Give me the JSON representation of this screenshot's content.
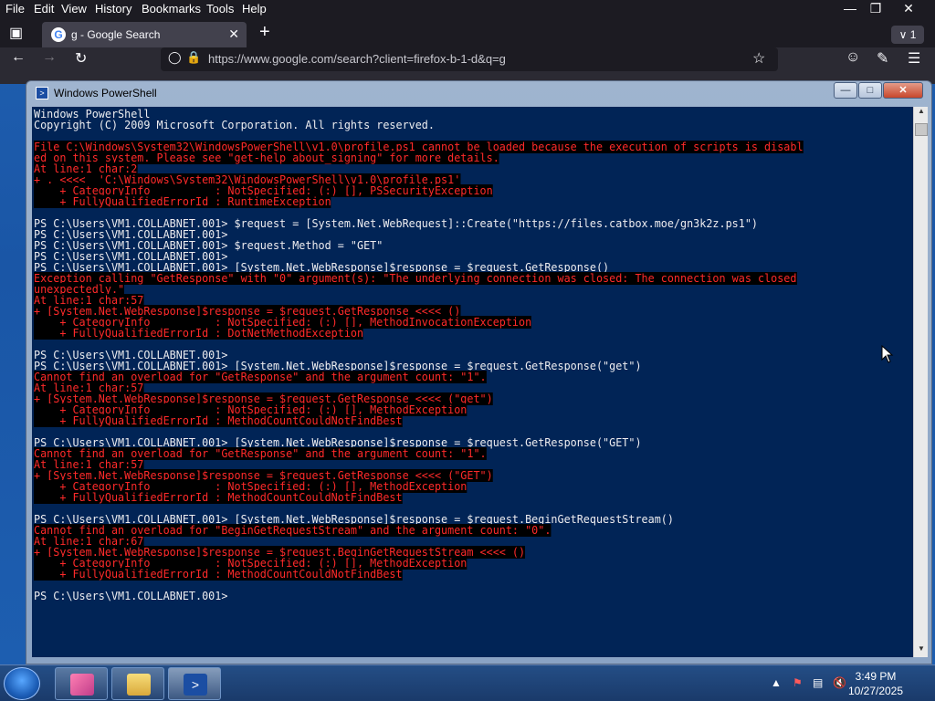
{
  "firefox": {
    "menu": [
      "File",
      "Edit",
      "View",
      "History",
      "Bookmarks",
      "Tools",
      "Help"
    ],
    "tab_title": "g - Google Search",
    "url": "https://www.google.com/search?client=firefox-b-1-d&q=g",
    "tab_count": "1"
  },
  "powershell": {
    "title": "Windows PowerShell",
    "lines": [
      {
        "t": "Windows PowerShell",
        "err": false
      },
      {
        "t": "Copyright (C) 2009 Microsoft Corporation. All rights reserved.",
        "err": false
      },
      {
        "t": "",
        "err": false
      },
      {
        "t": "File C:\\Windows\\System32\\WindowsPowerShell\\v1.0\\profile.ps1 cannot be loaded because the execution of scripts is disabl",
        "err": true
      },
      {
        "t": "ed on this system. Please see \"get-help about_signing\" for more details.",
        "err": true
      },
      {
        "t": "At line:1 char:2",
        "err": true
      },
      {
        "t": "+ . <<<<  'C:\\Windows\\System32\\WindowsPowerShell\\v1.0\\profile.ps1'",
        "err": true
      },
      {
        "t": "    + CategoryInfo          : NotSpecified: (:) [], PSSecurityException",
        "err": true
      },
      {
        "t": "    + FullyQualifiedErrorId : RuntimeException",
        "err": true
      },
      {
        "t": "",
        "err": false
      },
      {
        "t": "PS C:\\Users\\VM1.COLLABNET.001> $request = [System.Net.WebRequest]::Create(\"https://files.catbox.moe/gn3k2z.ps1\")",
        "err": false
      },
      {
        "t": "PS C:\\Users\\VM1.COLLABNET.001>",
        "err": false
      },
      {
        "t": "PS C:\\Users\\VM1.COLLABNET.001> $request.Method = \"GET\"",
        "err": false
      },
      {
        "t": "PS C:\\Users\\VM1.COLLABNET.001>",
        "err": false
      },
      {
        "t": "PS C:\\Users\\VM1.COLLABNET.001> [System.Net.WebResponse]$response = $request.GetResponse()",
        "err": false
      },
      {
        "t": "Exception calling \"GetResponse\" with \"0\" argument(s): \"The underlying connection was closed: The connection was closed",
        "err": true
      },
      {
        "t": "unexpectedly.\"",
        "err": true
      },
      {
        "t": "At line:1 char:57",
        "err": true
      },
      {
        "t": "+ [System.Net.WebResponse]$response = $request.GetResponse <<<< ()",
        "err": true
      },
      {
        "t": "    + CategoryInfo          : NotSpecified: (:) [], MethodInvocationException",
        "err": true
      },
      {
        "t": "    + FullyQualifiedErrorId : DotNetMethodException",
        "err": true
      },
      {
        "t": "",
        "err": false
      },
      {
        "t": "PS C:\\Users\\VM1.COLLABNET.001>",
        "err": false
      },
      {
        "t": "PS C:\\Users\\VM1.COLLABNET.001> [System.Net.WebResponse]$response = $request.GetResponse(\"get\")",
        "err": false
      },
      {
        "t": "Cannot find an overload for \"GetResponse\" and the argument count: \"1\".",
        "err": true
      },
      {
        "t": "At line:1 char:57",
        "err": true
      },
      {
        "t": "+ [System.Net.WebResponse]$response = $request.GetResponse <<<< (\"get\")",
        "err": true
      },
      {
        "t": "    + CategoryInfo          : NotSpecified: (:) [], MethodException",
        "err": true
      },
      {
        "t": "    + FullyQualifiedErrorId : MethodCountCouldNotFindBest",
        "err": true
      },
      {
        "t": "",
        "err": false
      },
      {
        "t": "PS C:\\Users\\VM1.COLLABNET.001> [System.Net.WebResponse]$response = $request.GetResponse(\"GET\")",
        "err": false
      },
      {
        "t": "Cannot find an overload for \"GetResponse\" and the argument count: \"1\".",
        "err": true
      },
      {
        "t": "At line:1 char:57",
        "err": true
      },
      {
        "t": "+ [System.Net.WebResponse]$response = $request.GetResponse <<<< (\"GET\")",
        "err": true
      },
      {
        "t": "    + CategoryInfo          : NotSpecified: (:) [], MethodException",
        "err": true
      },
      {
        "t": "    + FullyQualifiedErrorId : MethodCountCouldNotFindBest",
        "err": true
      },
      {
        "t": "",
        "err": false
      },
      {
        "t": "PS C:\\Users\\VM1.COLLABNET.001> [System.Net.WebResponse]$response = $request.BeginGetRequestStream()",
        "err": false
      },
      {
        "t": "Cannot find an overload for \"BeginGetRequestStream\" and the argument count: \"0\".",
        "err": true
      },
      {
        "t": "At line:1 char:67",
        "err": true
      },
      {
        "t": "+ [System.Net.WebResponse]$response = $request.BeginGetRequestStream <<<< ()",
        "err": true
      },
      {
        "t": "    + CategoryInfo          : NotSpecified: (:) [], MethodException",
        "err": true
      },
      {
        "t": "    + FullyQualifiedErrorId : MethodCountCouldNotFindBest",
        "err": true
      },
      {
        "t": "",
        "err": false
      },
      {
        "t": "PS C:\\Users\\VM1.COLLABNET.001>",
        "err": false
      }
    ],
    "colors": {
      "background": "#012456",
      "error_text": "#ff2a2a",
      "error_bg": "#000000",
      "text": "#eeedf0"
    }
  },
  "taskbar": {
    "time": "3:49 PM",
    "date": "10/27/2025"
  }
}
